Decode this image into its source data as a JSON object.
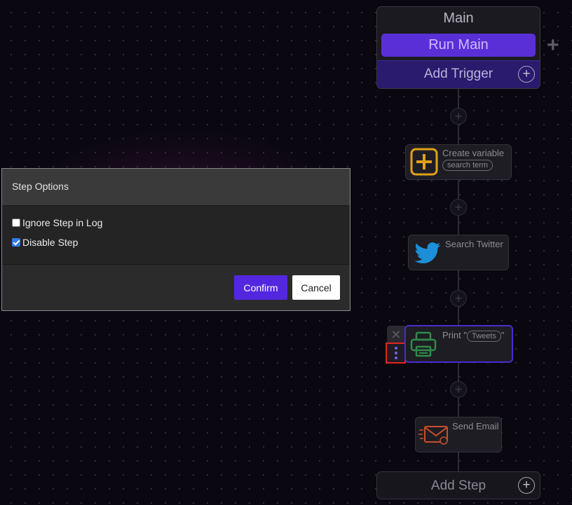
{
  "flow": {
    "main_title": "Main",
    "run_label": "Run Main",
    "trigger_label": "Add Trigger",
    "add_step_label": "Add Step",
    "steps": [
      {
        "label": "Create variable",
        "tag": "search term",
        "icon": "plus-box-icon"
      },
      {
        "label": "Search Twitter",
        "icon": "twitter-bird-icon"
      },
      {
        "label_prefix": "Print \"",
        "tag": "Tweets",
        "label_suffix": "\"",
        "icon": "printer-icon"
      },
      {
        "label": "Send Email",
        "icon": "email-icon"
      }
    ],
    "step_close_glyph": "✕",
    "plus_glyph": "+"
  },
  "dialog": {
    "title": "Step Options",
    "options": [
      {
        "label": "Ignore Step in Log",
        "checked": false
      },
      {
        "label": "Disable Step",
        "checked": true
      }
    ],
    "confirm_label": "Confirm",
    "cancel_label": "Cancel"
  },
  "colors": {
    "accent": "#5327e0",
    "run_button": "#5a2fd8",
    "selected_step_border": "#4a2bd0",
    "create_variable_icon": "#e0a21a",
    "print_icon": "#2e8b4a",
    "email_icon": "#c84e2c",
    "twitter_icon": "#1d8fd8"
  }
}
